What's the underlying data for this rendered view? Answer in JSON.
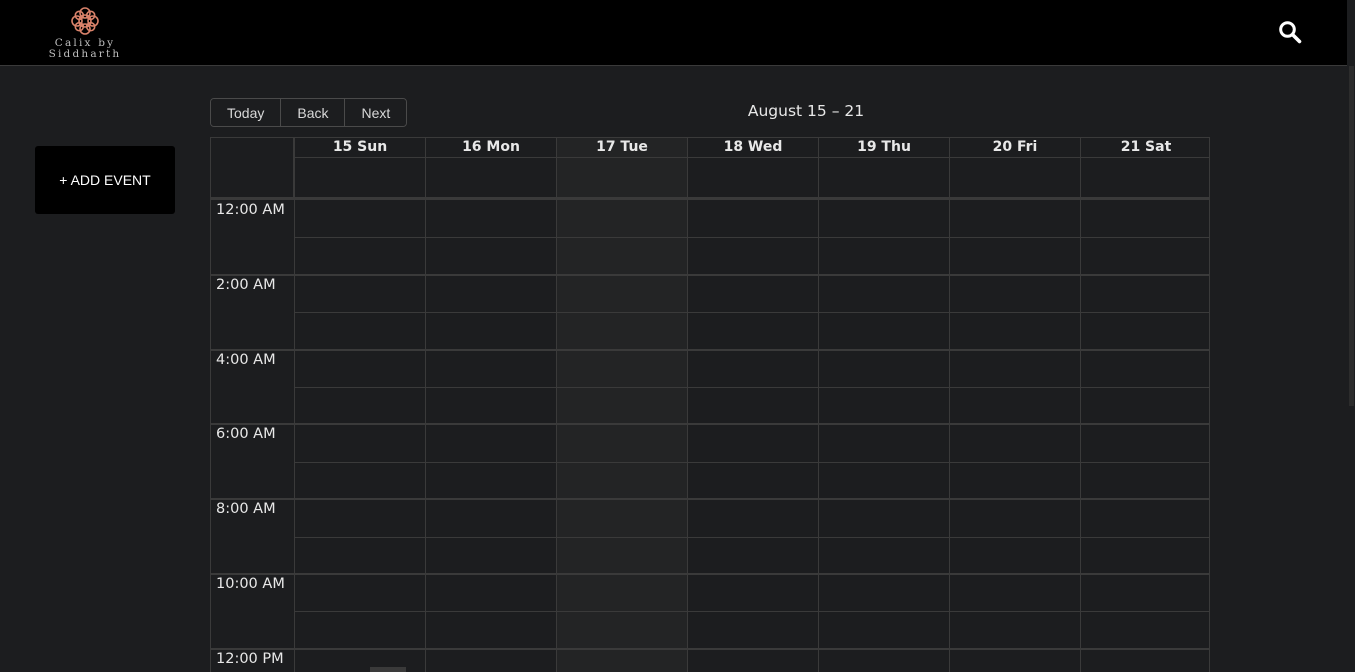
{
  "brand": {
    "line1": "Calix by",
    "line2": "Siddharth",
    "accent": "#d9826a"
  },
  "header": {
    "search_icon": "search-icon"
  },
  "sidebar": {
    "add_event_label": "+ ADD EVENT"
  },
  "toolbar": {
    "today": "Today",
    "back": "Back",
    "next": "Next",
    "range": "August 15 – 21"
  },
  "calendar": {
    "days": [
      "15 Sun",
      "16 Mon",
      "17 Tue",
      "18 Wed",
      "19 Thu",
      "20 Fri",
      "21 Sat"
    ],
    "today_index": 2,
    "times": [
      "12:00 AM",
      "2:00 AM",
      "4:00 AM",
      "6:00 AM",
      "8:00 AM",
      "10:00 AM",
      "12:00 PM"
    ]
  }
}
